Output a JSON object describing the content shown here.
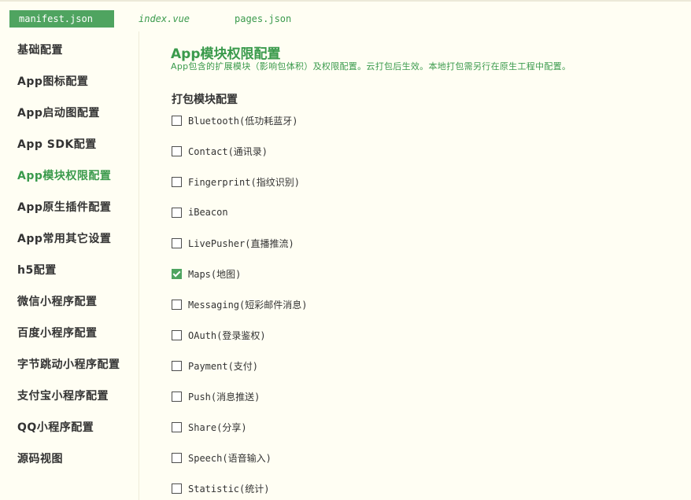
{
  "tabs": [
    {
      "label": "manifest.json",
      "active": true
    },
    {
      "label": "index.vue",
      "active": false
    },
    {
      "label": "pages.json",
      "active": false
    }
  ],
  "sidebar": {
    "items": [
      {
        "label": "基础配置",
        "active": false
      },
      {
        "label": "App图标配置",
        "active": false
      },
      {
        "label": "App启动图配置",
        "active": false
      },
      {
        "label": "App SDK配置",
        "active": false
      },
      {
        "label": "App模块权限配置",
        "active": true
      },
      {
        "label": "App原生插件配置",
        "active": false
      },
      {
        "label": "App常用其它设置",
        "active": false
      },
      {
        "label": "h5配置",
        "active": false
      },
      {
        "label": "微信小程序配置",
        "active": false
      },
      {
        "label": "百度小程序配置",
        "active": false
      },
      {
        "label": "字节跳动小程序配置",
        "active": false
      },
      {
        "label": "支付宝小程序配置",
        "active": false
      },
      {
        "label": "QQ小程序配置",
        "active": false
      },
      {
        "label": "源码视图",
        "active": false
      }
    ]
  },
  "main": {
    "title": "App模块权限配置",
    "description": "App包含的扩展模块（影响包体积）及权限配置。云打包后生效。本地打包需另行在原生工程中配置。",
    "section_title": "打包模块配置",
    "modules": [
      {
        "label": "Bluetooth(低功耗蓝牙)",
        "checked": false
      },
      {
        "label": "Contact(通讯录)",
        "checked": false
      },
      {
        "label": "Fingerprint(指纹识别)",
        "checked": false
      },
      {
        "label": "iBeacon",
        "checked": false
      },
      {
        "label": "LivePusher(直播推流)",
        "checked": false
      },
      {
        "label": "Maps(地图)",
        "checked": true
      },
      {
        "label": "Messaging(短彩邮件消息)",
        "checked": false
      },
      {
        "label": "OAuth(登录鉴权)",
        "checked": false
      },
      {
        "label": "Payment(支付)",
        "checked": false
      },
      {
        "label": "Push(消息推送)",
        "checked": false
      },
      {
        "label": "Share(分享)",
        "checked": false
      },
      {
        "label": "Speech(语音输入)",
        "checked": false
      },
      {
        "label": "Statistic(统计)",
        "checked": false
      }
    ]
  },
  "colors": {
    "accent": "#4fa460",
    "accent_text": "#3a9a4c",
    "background": "#fffef3",
    "text": "#333333"
  }
}
